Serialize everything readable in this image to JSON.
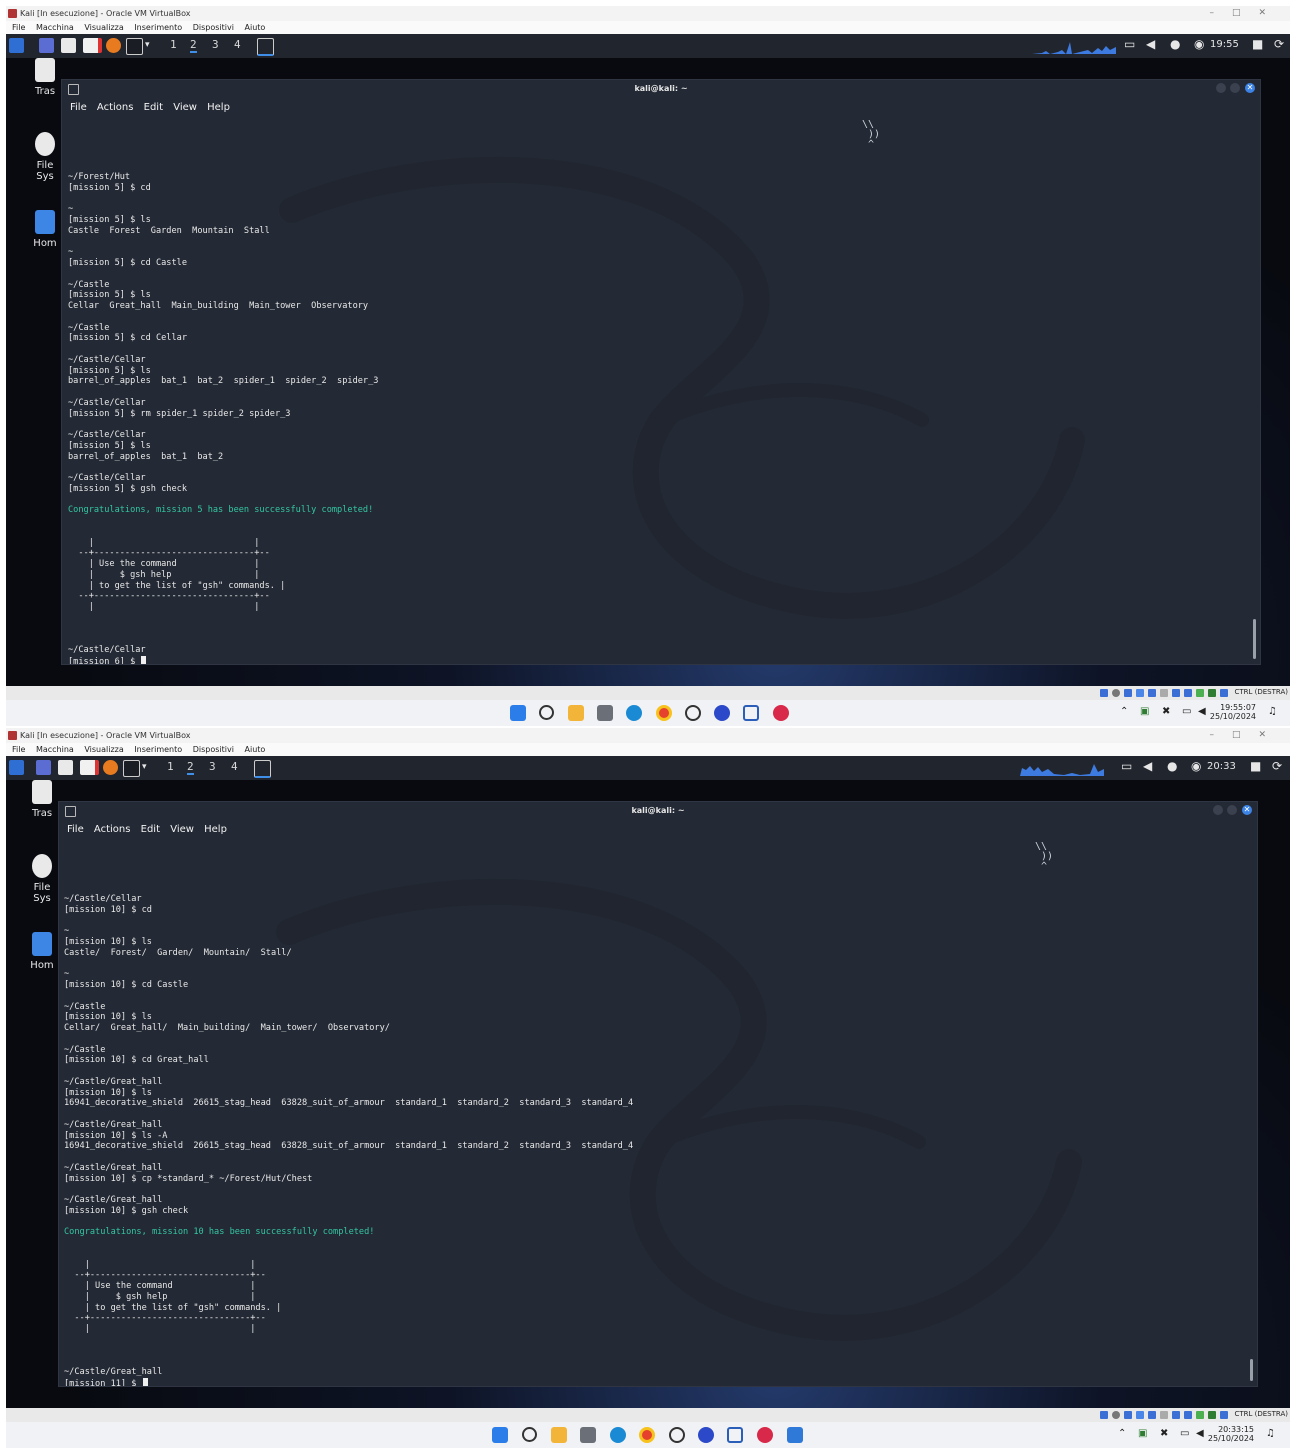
{
  "window_title": "Kali [In esecuzione] - Oracle VM VirtualBox",
  "vbox_menu": [
    "File",
    "Macchina",
    "Visualizza",
    "Inserimento",
    "Dispositivi",
    "Aiuto"
  ],
  "workspaces": [
    "1",
    "2",
    "3",
    "4"
  ],
  "desktop_icons": {
    "trash": "Tras",
    "filesystem": "File Sys",
    "home": "Hom"
  },
  "terminal": {
    "title": "kali@kali: ~",
    "menu": [
      "File",
      "Actions",
      "Edit",
      "View",
      "Help"
    ]
  },
  "host_label": "CTRL (DESTRA)",
  "session1": {
    "panel_clock": "19:55",
    "lines": [
      "~/Forest/Hut",
      "[mission 5] $ cd",
      "",
      "~",
      "[mission 5] $ ls",
      "Castle  Forest  Garden  Mountain  Stall",
      "",
      "~",
      "[mission 5] $ cd Castle",
      "",
      "~/Castle",
      "[mission 5] $ ls",
      "Cellar  Great_hall  Main_building  Main_tower  Observatory",
      "",
      "~/Castle",
      "[mission 5] $ cd Cellar",
      "",
      "~/Castle/Cellar",
      "[mission 5] $ ls",
      "barrel_of_apples  bat_1  bat_2  spider_1  spider_2  spider_3",
      "",
      "~/Castle/Cellar",
      "[mission 5] $ rm spider_1 spider_2 spider_3",
      "",
      "~/Castle/Cellar",
      "[mission 5] $ ls",
      "barrel_of_apples  bat_1  bat_2",
      "",
      "~/Castle/Cellar",
      "[mission 5] $ gsh check",
      ""
    ],
    "congrats": "Congratulations, mission 5 has been successfully completed!",
    "box": [
      "",
      "",
      "    |                               |",
      "  --+-------------------------------+--",
      "    | Use the command               |",
      "    |     $ gsh help                |",
      "    | to get the list of \"gsh\" commands. |",
      "  --+-------------------------------+--",
      "    |                               |",
      "",
      ""
    ],
    "prompt_path": "~/Castle/Cellar",
    "prompt": "[mission 6] $ ",
    "taskbar_time": "19:55:07",
    "taskbar_date": "25/10/2024"
  },
  "session2": {
    "panel_clock": "20:33",
    "lines": [
      "~/Castle/Cellar",
      "[mission 10] $ cd",
      "",
      "~",
      "[mission 10] $ ls",
      "Castle/  Forest/  Garden/  Mountain/  Stall/",
      "",
      "~",
      "[mission 10] $ cd Castle",
      "",
      "~/Castle",
      "[mission 10] $ ls",
      "Cellar/  Great_hall/  Main_building/  Main_tower/  Observatory/",
      "",
      "~/Castle",
      "[mission 10] $ cd Great_hall",
      "",
      "~/Castle/Great_hall",
      "[mission 10] $ ls",
      "16941_decorative_shield  26615_stag_head  63828_suit_of_armour  standard_1  standard_2  standard_3  standard_4",
      "",
      "~/Castle/Great_hall",
      "[mission 10] $ ls -A",
      "16941_decorative_shield  26615_stag_head  63828_suit_of_armour  standard_1  standard_2  standard_3  standard_4",
      "",
      "~/Castle/Great_hall",
      "[mission 10] $ cp *standard_* ~/Forest/Hut/Chest",
      "",
      "~/Castle/Great_hall",
      "[mission 10] $ gsh check",
      ""
    ],
    "congrats": "Congratulations, mission 10 has been successfully completed!",
    "box": [
      "",
      "",
      "    |                               |",
      "  --+-------------------------------+--",
      "    | Use the command               |",
      "    |     $ gsh help                |",
      "    | to get the list of \"gsh\" commands. |",
      "  --+-------------------------------+--",
      "    |                               |",
      "",
      ""
    ],
    "prompt_path": "~/Castle/Great_hall",
    "prompt": "[mission 11] $ ",
    "taskbar_time": "20:33:15",
    "taskbar_date": "25/10/2024"
  },
  "colors": {
    "accent": "#3c83e6",
    "success_text": "#33c6a2",
    "terminal_bg": "#242a35",
    "panel_bg": "#21252e"
  },
  "icons": [
    "kali-menu-icon",
    "terminal-icon",
    "firefox-icon",
    "folder-icon",
    "text-editor-icon",
    "volume-icon",
    "bell-icon",
    "lock-icon",
    "power-icon",
    "windows-start-icon",
    "search-icon",
    "edge-icon",
    "chrome-icon",
    "whatsapp-icon"
  ]
}
